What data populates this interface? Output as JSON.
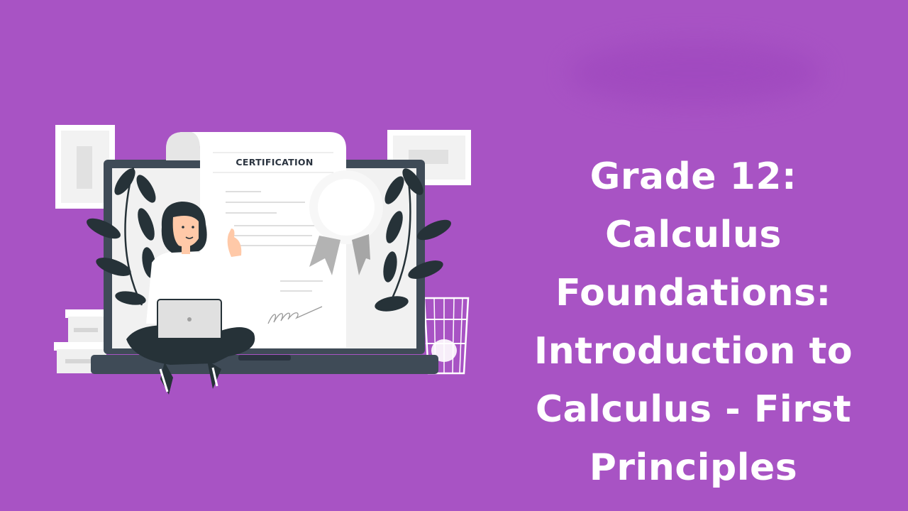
{
  "slide": {
    "title": "Grade 12: Calculus Foundations: Introduction to Calculus - First Principles",
    "certificate_heading": "CERTIFICATION"
  },
  "colors": {
    "background": "#a853c4",
    "title_text": "#ffffff",
    "laptop_frame": "#3f4b57",
    "leaves": "#263238",
    "paper": "#ffffff",
    "ribbon": "#b3b3b3"
  },
  "illustration": {
    "subject": "person-with-laptop-and-certificate",
    "icons": [
      "laptop-icon",
      "certificate-icon",
      "person-icon",
      "leaf-branch-icon",
      "wastebasket-icon",
      "storage-box-icon",
      "wall-frame-icon"
    ]
  }
}
